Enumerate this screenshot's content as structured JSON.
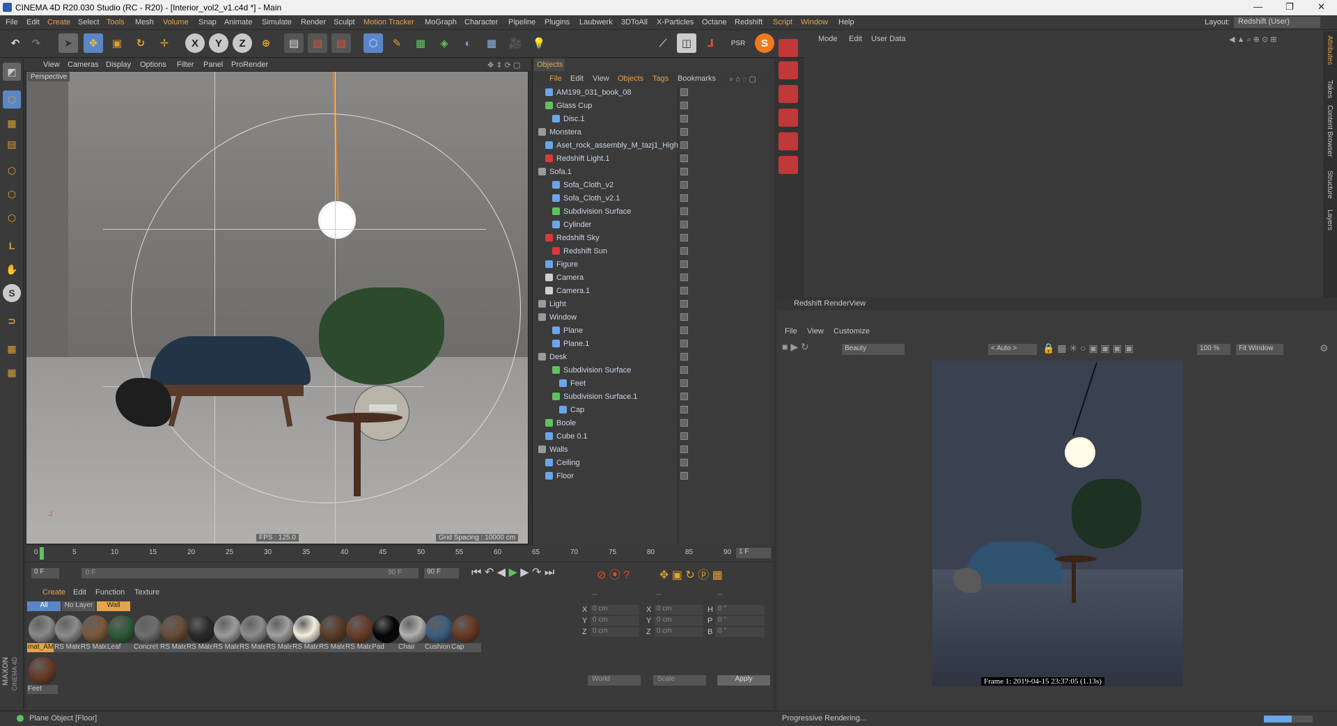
{
  "window": {
    "title": "CINEMA 4D R20.030 Studio (RC - R20) - [Interior_vol2_v1.c4d *] - Main",
    "minimize": "—",
    "maximize": "❐",
    "close": "✕"
  },
  "menubar": [
    "File",
    "Edit",
    "Create",
    "Select",
    "Tools",
    "Mesh",
    "Volume",
    "Snap",
    "Animate",
    "Simulate",
    "Render",
    "Sculpt",
    "Motion Tracker",
    "MoGraph",
    "Character",
    "Pipeline",
    "Plugins",
    "Laubwerk",
    "3DToAll",
    "X-Particles",
    "Octane",
    "Redshift",
    "Script",
    "Window",
    "Help"
  ],
  "layout": {
    "label": "Layout:",
    "value": "Redshift (User)"
  },
  "viewport": {
    "menu": [
      "View",
      "Cameras",
      "Display",
      "Options",
      "Filter",
      "Panel",
      "ProRender"
    ],
    "label": "Perspective",
    "fps": "FPS : 125.0",
    "grid": "Grid Spacing : 10000 cm"
  },
  "objects": {
    "tab": "Objects",
    "menu": [
      "File",
      "Edit",
      "View",
      "Objects",
      "Tags",
      "Bookmarks"
    ],
    "rows": [
      {
        "name": "AM199_031_book_08",
        "indent": 1,
        "color": "#6aa6e8"
      },
      {
        "name": "Glass Cup",
        "indent": 1,
        "color": "#5fc25f"
      },
      {
        "name": "Disc.1",
        "indent": 2,
        "color": "#6aa6e8"
      },
      {
        "name": "Monstera",
        "indent": 0,
        "color": "#9a9a9a"
      },
      {
        "name": "Aset_rock_assembly_M_tazj1_High",
        "indent": 1,
        "color": "#6aa6e8"
      },
      {
        "name": "Redshift Light.1",
        "indent": 1,
        "color": "#d83a3a"
      },
      {
        "name": "Sofa.1",
        "indent": 0,
        "color": "#9a9a9a"
      },
      {
        "name": "Sofa_Cloth_v2",
        "indent": 2,
        "color": "#6aa6e8"
      },
      {
        "name": "Sofa_Cloth_v2.1",
        "indent": 2,
        "color": "#6aa6e8"
      },
      {
        "name": "Subdivision Surface",
        "indent": 2,
        "color": "#5fc25f"
      },
      {
        "name": "Cylinder",
        "indent": 2,
        "color": "#6aa6e8"
      },
      {
        "name": "Redshift Sky",
        "indent": 1,
        "color": "#d83a3a"
      },
      {
        "name": "Redshift Sun",
        "indent": 2,
        "color": "#d83a3a"
      },
      {
        "name": "Figure",
        "indent": 1,
        "color": "#6aa6e8"
      },
      {
        "name": "Camera",
        "indent": 1,
        "color": "#cfcfcf"
      },
      {
        "name": "Camera.1",
        "indent": 1,
        "color": "#cfcfcf"
      },
      {
        "name": "Light",
        "indent": 0,
        "color": "#9a9a9a"
      },
      {
        "name": "Window",
        "indent": 0,
        "color": "#9a9a9a"
      },
      {
        "name": "Plane",
        "indent": 2,
        "color": "#6aa6e8"
      },
      {
        "name": "Plane.1",
        "indent": 2,
        "color": "#6aa6e8"
      },
      {
        "name": "Desk",
        "indent": 0,
        "color": "#9a9a9a"
      },
      {
        "name": "Subdivision Surface",
        "indent": 2,
        "color": "#5fc25f"
      },
      {
        "name": "Feet",
        "indent": 3,
        "color": "#6aa6e8"
      },
      {
        "name": "Subdivision Surface.1",
        "indent": 2,
        "color": "#5fc25f"
      },
      {
        "name": "Cap",
        "indent": 3,
        "color": "#6aa6e8"
      },
      {
        "name": "Boole",
        "indent": 1,
        "color": "#5fc25f"
      },
      {
        "name": "Cube 0.1",
        "indent": 1,
        "color": "#6aa6e8"
      },
      {
        "name": "Walls",
        "indent": 0,
        "color": "#9a9a9a"
      },
      {
        "name": "Ceiling",
        "indent": 1,
        "color": "#6aa6e8"
      },
      {
        "name": "Floor",
        "indent": 1,
        "color": "#6aa6e8"
      }
    ]
  },
  "attributes": {
    "menu": [
      "Mode",
      "Edit",
      "User Data"
    ]
  },
  "sidetabs": [
    "Attributes",
    "Takes",
    "Content Browser",
    "Structure",
    "Layers"
  ],
  "renderview": {
    "title": "Redshift RenderView",
    "menu": [
      "File",
      "View",
      "Customize"
    ],
    "aov": "Beauty",
    "auto": "< Auto >",
    "zoom": "100 %",
    "fit": "Fit Window",
    "frameinfo": "Frame 1: 2019-04-15 23:37:05 (1.13s)",
    "status": "Progressive Rendering..."
  },
  "timeline": {
    "ticks": [
      "0",
      "5",
      "10",
      "15",
      "20",
      "25",
      "30",
      "35",
      "40",
      "45",
      "50",
      "55",
      "60",
      "65",
      "70",
      "75",
      "80",
      "85",
      "90"
    ],
    "current": "1 F"
  },
  "transport": {
    "start": "0 F",
    "field": "0 F",
    "end": "90 F",
    "end2": "90 F"
  },
  "materials": {
    "menu": [
      "Create",
      "Edit",
      "Function",
      "Texture"
    ],
    "filters": [
      "All",
      "No Layer",
      "Wall"
    ],
    "items": [
      {
        "label": "mat_AM",
        "color": "#8a8a8a"
      },
      {
        "label": "RS Mate",
        "color": "#8c8c8c"
      },
      {
        "label": "RS Mate",
        "color": "#7a5a3a"
      },
      {
        "label": "Leaf",
        "color": "#2d5a36"
      },
      {
        "label": "Concret",
        "color": "#6e6e6e"
      },
      {
        "label": "RS Mate",
        "color": "#6a4c36"
      },
      {
        "label": "RS Mate",
        "color": "#2a2a2a"
      },
      {
        "label": "RS Mate",
        "color": "#9c9c9c"
      },
      {
        "label": "RS Mate",
        "color": "#8c8c8c"
      },
      {
        "label": "RS Mate",
        "color": "#a0a0a0"
      },
      {
        "label": "RS Mate",
        "color": "#f3f0e0"
      },
      {
        "label": "RS Mate",
        "color": "#5a3c26"
      },
      {
        "label": "RS Mate",
        "color": "#6a3c28"
      },
      {
        "label": "Pad",
        "color": "#050505"
      },
      {
        "label": "Chair",
        "color": "#b0b0b0"
      },
      {
        "label": "Cushion",
        "color": "#3a5f82"
      },
      {
        "label": "Cap",
        "color": "#6a3a24"
      },
      {
        "label": "Feet",
        "color": "#6a3a28"
      }
    ]
  },
  "coords": {
    "headers": [
      "--",
      "--",
      "--"
    ],
    "rows": [
      {
        "a": "X",
        "av": "0 cm",
        "b": "X",
        "bv": "0 cm",
        "c": "H",
        "cv": "0 °"
      },
      {
        "a": "Y",
        "av": "0 cm",
        "b": "Y",
        "bv": "0 cm",
        "c": "P",
        "cv": "0 °"
      },
      {
        "a": "Z",
        "av": "0 cm",
        "b": "Z",
        "bv": "0 cm",
        "c": "B",
        "cv": "0 °"
      }
    ],
    "world": "World",
    "scale": "Scale",
    "apply": "Apply"
  },
  "status": {
    "text": "Plane Object [Floor]"
  },
  "brand": {
    "maxon": "MAXON",
    "c4d": "CINEMA 4D"
  },
  "colors": {
    "accent": "#e6a44a",
    "active": "#5a86c8",
    "rsred": "#c03838"
  }
}
